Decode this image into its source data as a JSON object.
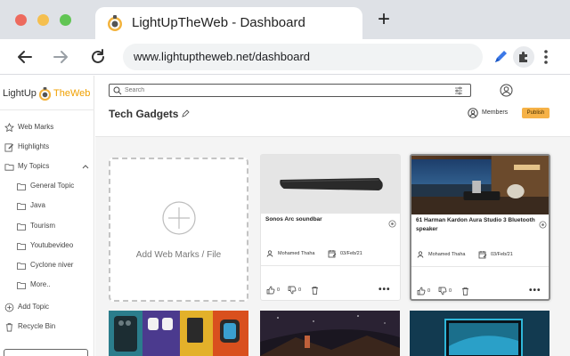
{
  "browser": {
    "tab_title": "LightUpTheWeb - Dashboard",
    "new_tab_icon": "plus-icon",
    "url": "www.lightuptheweb.net/dashboard"
  },
  "sidebar": {
    "logo_text_a": "LightUp",
    "logo_text_b": "TheWeb",
    "items": [
      {
        "label": "Web Marks",
        "icon": "star-icon"
      },
      {
        "label": "Highlights",
        "icon": "edit-icon"
      },
      {
        "label": "My Topics",
        "icon": "folder-icon"
      },
      {
        "label": "Add Topic",
        "icon": "plus-circle-icon"
      },
      {
        "label": "Recycle Bin",
        "icon": "trash-icon"
      }
    ],
    "topics": [
      "General Topic",
      "Java",
      "Tourism",
      "Youtubevideo",
      "Cyclone niver",
      "More.."
    ]
  },
  "main": {
    "search_placeholder": "Search",
    "page_title": "Tech Gadgets",
    "members_label": "Members",
    "publish_label": "Publish",
    "add_card_label": "Add Web Marks / File"
  },
  "cards": [
    {
      "title": "Sonos Arc soundbar",
      "user": "Mohamed Thaha",
      "date": "03/Feb/21",
      "likes": "0",
      "dislikes": "0"
    },
    {
      "title": "61 Harman Kardon Aura Studio 3 Bluetooth speaker",
      "user": "Mohamed Thaha",
      "date": "03/Feb/21",
      "likes": "0",
      "dislikes": "0"
    }
  ],
  "colors": {
    "accent": "#f6b247",
    "logo": "#f0a000",
    "tab_strip": "#dee1e6"
  }
}
